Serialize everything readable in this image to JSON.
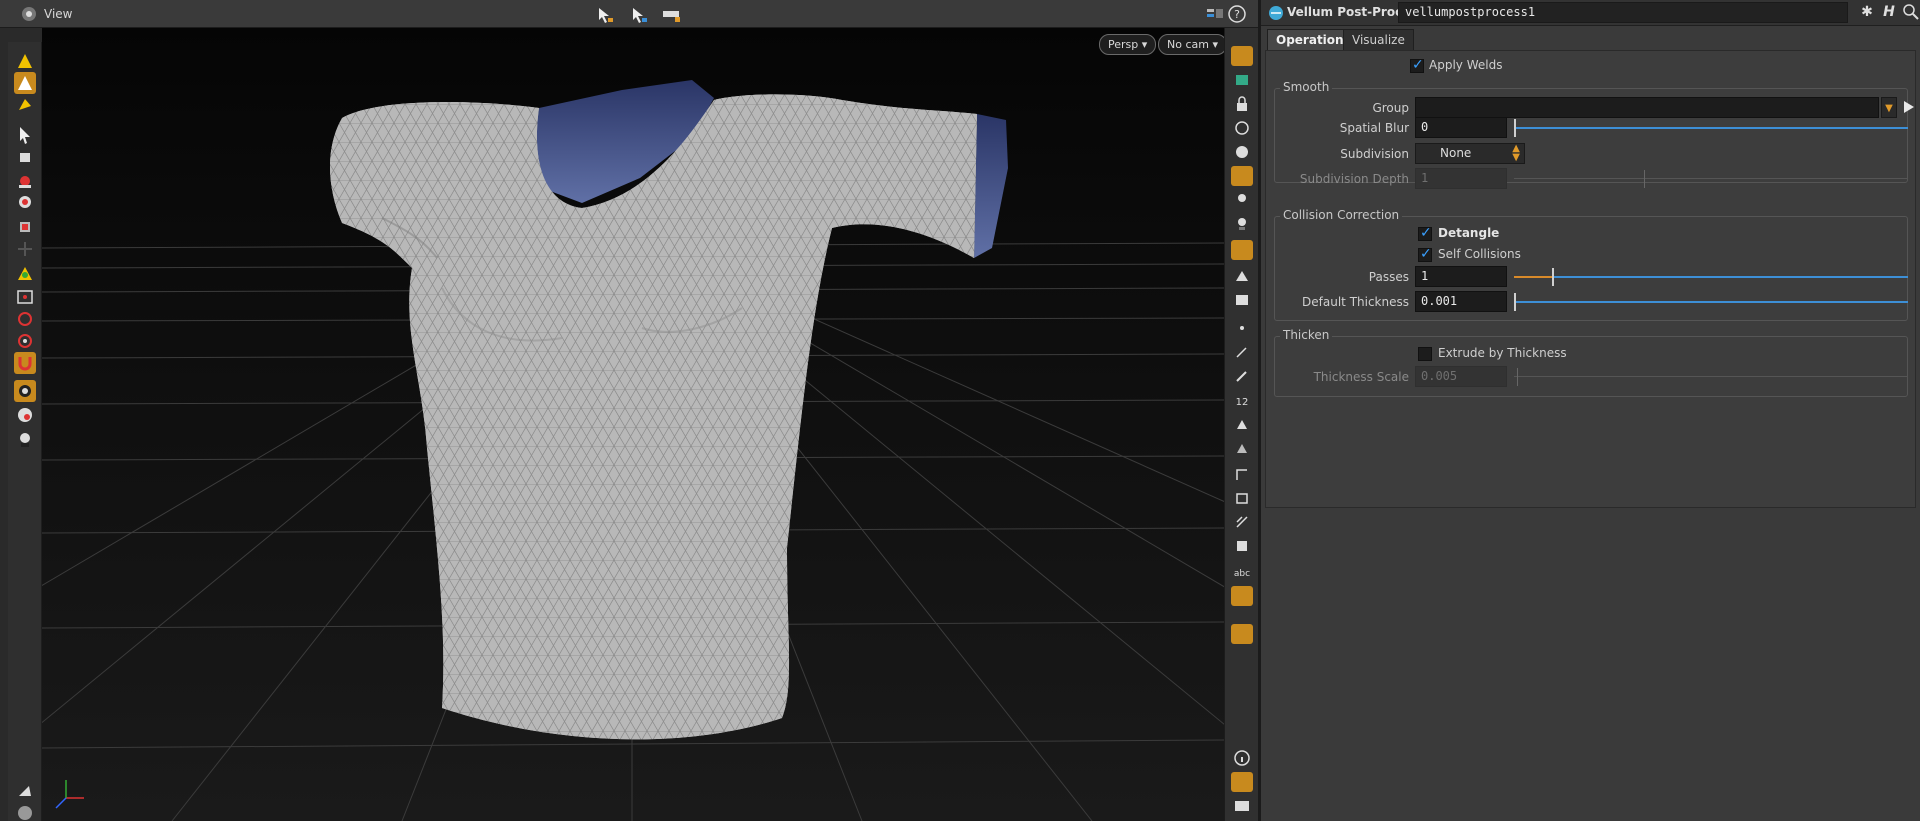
{
  "viewer": {
    "title": "View",
    "persp_menu": "Persp",
    "cam_menu": "No cam",
    "help_icon": "?"
  },
  "params": {
    "node_type": "Vellum Post-Process",
    "node_name": "vellumpostprocess1",
    "tabs": [
      "Operations",
      "Visualize"
    ],
    "apply_welds": {
      "label": "Apply Welds",
      "checked": true
    },
    "smooth": {
      "title": "Smooth",
      "group_label": "Group",
      "group_value": "",
      "spatial_blur_label": "Spatial Blur",
      "spatial_blur_value": "0",
      "subdivision_label": "Subdivision",
      "subdivision_value": "None",
      "subdivision_depth_label": "Subdivision Depth",
      "subdivision_depth_value": "1"
    },
    "collision": {
      "title": "Collision Correction",
      "detangle_label": "Detangle",
      "detangle_checked": true,
      "self_collisions_label": "Self Collisions",
      "self_collisions_checked": true,
      "passes_label": "Passes",
      "passes_value": "1",
      "default_thickness_label": "Default Thickness",
      "default_thickness_value": "0.001"
    },
    "thicken": {
      "title": "Thicken",
      "extrude_label": "Extrude by Thickness",
      "extrude_checked": false,
      "thickness_scale_label": "Thickness Scale",
      "thickness_scale_value": "0.005"
    }
  },
  "colors": {
    "accent_orange": "#c88a1e",
    "slider_blue": "#3d8fd6",
    "checkbox_blue": "#3aa0ff",
    "cloth_gray": "#b9b9b9",
    "cloth_inner_blue": "#3b4a7a"
  }
}
